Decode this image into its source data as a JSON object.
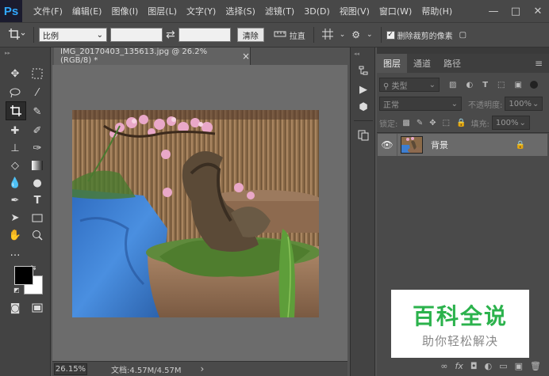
{
  "app": {
    "logo": "Ps",
    "window_controls": [
      "—",
      "□",
      "✕"
    ]
  },
  "menu": [
    "文件(F)",
    "编辑(E)",
    "图像(I)",
    "图层(L)",
    "文字(Y)",
    "选择(S)",
    "滤镜(T)",
    "3D(D)",
    "视图(V)",
    "窗口(W)",
    "帮助(H)"
  ],
  "options": {
    "ratio": "比例",
    "swap_icon": "⇄",
    "clear": "清除",
    "straighten": "拉直",
    "delete_cropped": "删除裁剪的像素",
    "delete_cropped_checked": "✓"
  },
  "document": {
    "tab_title": "IMG_20170403_135613.jpg @ 26.2%(RGB/8) *",
    "close": "×",
    "zoom": "26.15%",
    "status": "文档:4.57M/4.57M",
    "status_arrow": "›"
  },
  "panel": {
    "tabs": [
      "图层",
      "通道",
      "路径"
    ],
    "filter_kind": "类型",
    "blend_mode": "正常",
    "opacity_label": "不透明度:",
    "opacity": "100%",
    "lock_label": "锁定:",
    "fill_label": "填充:",
    "fill": "100%",
    "layer_name": "背景",
    "bottom_icons": [
      "∞",
      "fx",
      "◘",
      "◐",
      "▭",
      "▣",
      "🗑"
    ]
  },
  "watermark": {
    "title": "百科全说",
    "subtitle": "助你轻松解决"
  },
  "colors": {
    "bg": "#535353",
    "menubar": "#484848",
    "accent_logo": "#31a8ff",
    "watermark_green": "#2bb24c"
  }
}
